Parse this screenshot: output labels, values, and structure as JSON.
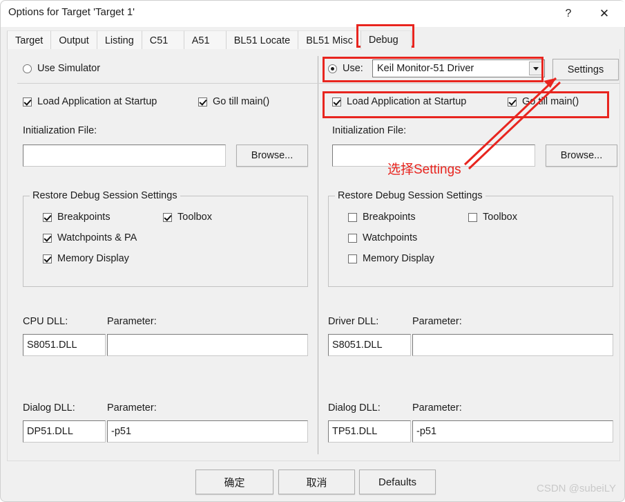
{
  "window": {
    "title": "Options for Target 'Target 1'",
    "help_icon": "?",
    "close_icon": "✕"
  },
  "tabs": [
    {
      "label": "Target",
      "selected": false
    },
    {
      "label": "Output",
      "selected": false
    },
    {
      "label": "Listing",
      "selected": false
    },
    {
      "label": "C51",
      "selected": false
    },
    {
      "label": "A51",
      "selected": false
    },
    {
      "label": "BL51 Locate",
      "selected": false
    },
    {
      "label": "BL51 Misc",
      "selected": false
    },
    {
      "label": "Debug",
      "selected": true
    }
  ],
  "left_panel": {
    "use_simulator": {
      "label": "Use Simulator",
      "checked": false
    },
    "load_app": {
      "label": "Load Application at Startup",
      "checked": true
    },
    "go_till_main": {
      "label": "Go  till main()",
      "checked": true
    },
    "init_file_label": "Initialization File:",
    "init_file_value": "",
    "browse_label": "Browse...",
    "restore_group_title": "Restore Debug Session Settings",
    "restore": [
      {
        "label": "Breakpoints",
        "checked": true
      },
      {
        "label": "Toolbox",
        "checked": true
      },
      {
        "label": "Watchpoints & PA",
        "checked": true
      },
      {
        "label": "Memory Display",
        "checked": true
      }
    ],
    "cpu_dll_label": "CPU DLL:",
    "cpu_dll_value": "S8051.DLL",
    "cpu_param_label": "Parameter:",
    "cpu_param_value": "",
    "dialog_dll_label": "Dialog DLL:",
    "dialog_dll_value": "DP51.DLL",
    "dialog_param_label": "Parameter:",
    "dialog_param_value": "-p51"
  },
  "right_panel": {
    "use": {
      "label": "Use:",
      "checked": true
    },
    "driver_value": "Keil Monitor-51 Driver",
    "settings_label": "Settings",
    "load_app": {
      "label": "Load Application at Startup",
      "checked": true
    },
    "go_till_main": {
      "label": "Go  till main()",
      "checked": true
    },
    "init_file_label": "Initialization File:",
    "init_file_value": "",
    "browse_label": "Browse...",
    "restore_group_title": "Restore Debug Session Settings",
    "restore": [
      {
        "label": "Breakpoints",
        "checked": false
      },
      {
        "label": "Toolbox",
        "checked": false
      },
      {
        "label": "Watchpoints",
        "checked": false
      },
      {
        "label": "Memory Display",
        "checked": false
      }
    ],
    "driver_dll_label": "Driver DLL:",
    "driver_dll_value": "S8051.DLL",
    "driver_param_label": "Parameter:",
    "driver_param_value": "",
    "dialog_dll_label": "Dialog DLL:",
    "dialog_dll_value": "TP51.DLL",
    "dialog_param_label": "Parameter:",
    "dialog_param_value": "-p51"
  },
  "footer": {
    "ok_label": "确定",
    "cancel_label": "取消",
    "defaults_label": "Defaults"
  },
  "annotations": {
    "note_text": "选择Settings",
    "highlight_color": "#e8251f"
  },
  "watermark": "CSDN @subeiLY"
}
